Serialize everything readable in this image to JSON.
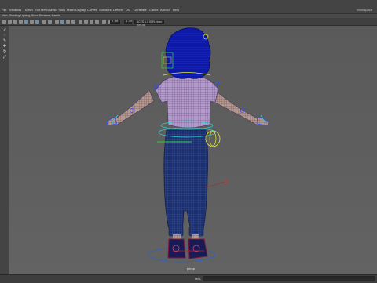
{
  "menubar": {
    "items": [
      "File",
      "Windows",
      "Mesh",
      "Edit Mesh",
      "Mesh Tools",
      "Mesh Display",
      "Curves",
      "Surfaces",
      "Deform",
      "UV",
      "Generate",
      "Cache",
      "Arnold",
      "Help"
    ],
    "workspace": "Workspace"
  },
  "panelbar": {
    "items": [
      "View",
      "Shading",
      "Lighting",
      "Show",
      "Renderer",
      "Panels"
    ]
  },
  "toolbar": {
    "field_1": "0.00",
    "field_2": "1.00",
    "colorspace": "ACES 1.0 SDR-video (sRGB)"
  },
  "toolbox": {
    "tools": [
      "select-tool",
      "lasso-tool",
      "paint-tool",
      "move-tool",
      "rotate-tool",
      "scale-tool"
    ],
    "glyphs": [
      "➚",
      "◌",
      "✎",
      "✥",
      "↻",
      "⤢"
    ]
  },
  "viewport": {
    "camera": "persp"
  },
  "commandline": {
    "label": "MEL"
  },
  "colors": {
    "wireframe_hair": "#0d1aa8",
    "wireframe_shirt": "#c4a6d8",
    "wireframe_pants": "#1c2f6a",
    "shoes": "#1a1a55",
    "control_yellow": "#e8e83a",
    "control_green": "#2ad42a",
    "selected_blue": "#2a4cff",
    "control_cyan": "#2ad4d4"
  }
}
